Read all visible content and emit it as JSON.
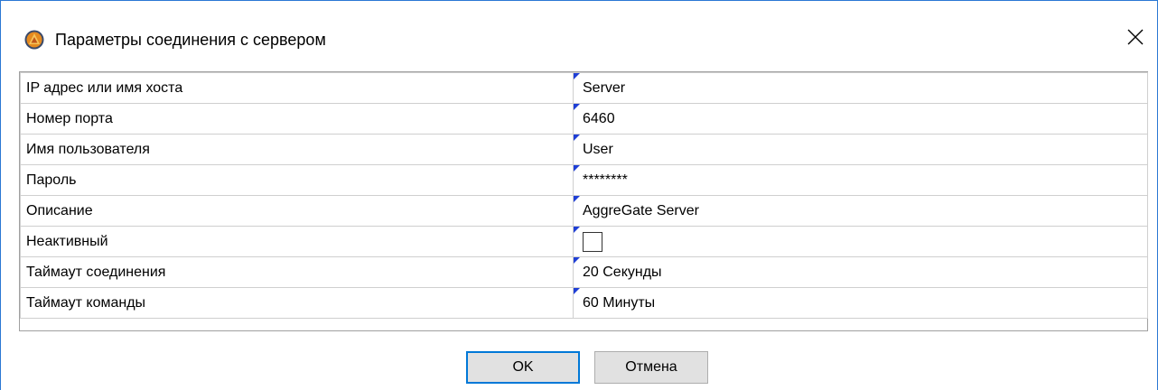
{
  "window": {
    "title": "Параметры соединения с сервером",
    "icon": "aggregate-logo-icon",
    "close_icon": "close-icon",
    "accent_color": "#2b78d4"
  },
  "properties": [
    {
      "name": "IP адрес или имя хоста",
      "value": "Server"
    },
    {
      "name": "Номер порта",
      "value": "6460"
    },
    {
      "name": "Имя пользователя",
      "value": "User"
    },
    {
      "name": "Пароль",
      "value": "********"
    },
    {
      "name": "Описание",
      "value": "AggreGate Server"
    },
    {
      "name": "Неактивный",
      "value": "",
      "checked": false
    },
    {
      "name": "Таймаут соединения",
      "value": "20 Секунды"
    },
    {
      "name": "Таймаут команды",
      "value": "60 Минуты"
    }
  ],
  "buttons": {
    "ok_label": "OK",
    "cancel_label": "Отмена"
  }
}
